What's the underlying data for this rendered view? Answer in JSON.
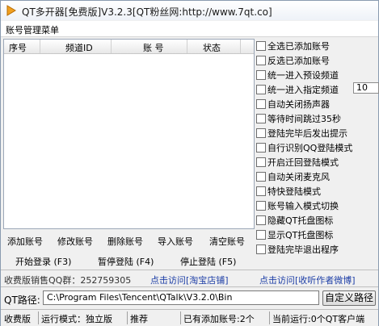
{
  "window": {
    "title": "QT多开器[免费版]V3.2.3[QT粉丝网:http://www.7qt.co]"
  },
  "menu": {
    "account_management": "账号管理菜单"
  },
  "list": {
    "columns": [
      "序号",
      "频道ID",
      "账 号",
      "状态"
    ]
  },
  "options": [
    {
      "label": "全选已添加账号",
      "checked": false
    },
    {
      "label": "反选已添加账号",
      "checked": false
    },
    {
      "label": "统一进入预设频道",
      "checked": false
    },
    {
      "label": "统一进入指定频道",
      "checked": false,
      "value": "10"
    },
    {
      "label": "自动关闭扬声器",
      "checked": false
    },
    {
      "label": "等待时间跳过35秒",
      "checked": false
    },
    {
      "label": "登陆完毕后发出提示",
      "checked": false
    },
    {
      "label": "自行识别QQ登陆模式",
      "checked": false
    },
    {
      "label": "开启迁回登陆模式",
      "checked": false
    },
    {
      "label": "自动关闭麦克风",
      "checked": false
    },
    {
      "label": "特快登陆模式",
      "checked": false
    },
    {
      "label": "账号输入模式切换",
      "checked": false
    },
    {
      "label": "隐藏QT托盘图标",
      "checked": false
    },
    {
      "label": "显示QT托盘图标",
      "checked": false
    },
    {
      "label": "登陆完毕退出程序",
      "checked": false
    }
  ],
  "actions": {
    "add_account": "添加账号",
    "edit_account": "修改账号",
    "delete_account": "删除账号",
    "import_account": "导入账号",
    "clear_account": "清空账号",
    "start_login": "开始登录 (F3)",
    "pause_login": "暂停登陆 (F4)",
    "stop_login": "停止登陆 (F5)"
  },
  "links": {
    "paid_qq": "收费版销售QQ群：252759305",
    "taobao": "点击访问[淘宝店铺]",
    "weibo": "点击访问[收听作者微博]"
  },
  "qt_path": {
    "label": "QT路径:",
    "value": "C:\\Program Files\\Tencent\\QTalk\\V3.2.0\\Bin",
    "custom_button": "自定义路径"
  },
  "statusbar": {
    "paid_version": "收费版",
    "mode": "运行模式：独立版",
    "recommend": "推荐",
    "added_accounts": "已有添加账号:2个",
    "running": "当前运行:0个QT客户端"
  },
  "colors": {
    "link": "#1d3ea6",
    "background": "#f0f0f0"
  }
}
